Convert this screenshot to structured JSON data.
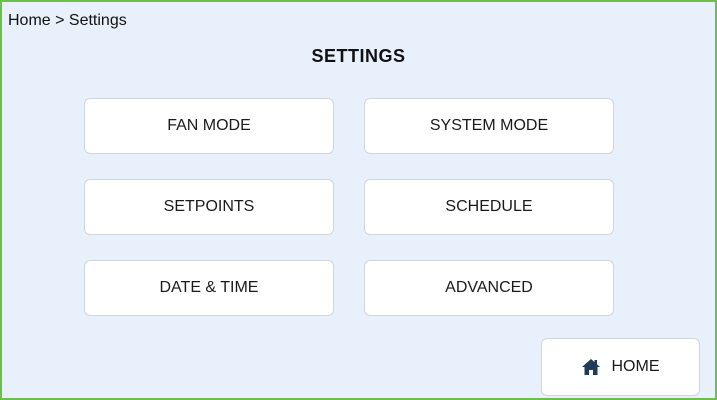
{
  "breadcrumb": "Home > Settings",
  "page_title": "SETTINGS",
  "buttons": {
    "fan_mode": "FAN MODE",
    "system_mode": "SYSTEM MODE",
    "setpoints": "SETPOINTS",
    "schedule": "SCHEDULE",
    "date_time": "DATE & TIME",
    "advanced": "ADVANCED",
    "home": "HOME"
  },
  "icons": {
    "home": "home-icon"
  },
  "colors": {
    "frame_border": "#6cc04a",
    "background": "#e8f1fb",
    "button_bg": "#ffffff",
    "icon_color": "#1f3b57"
  }
}
